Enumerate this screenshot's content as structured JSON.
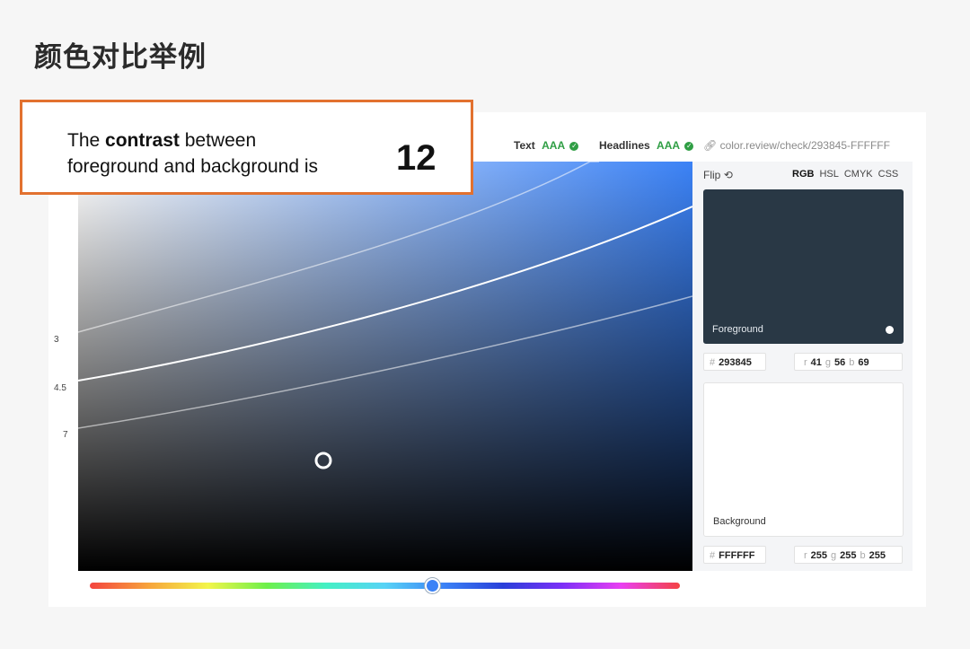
{
  "page_title": "颜色对比举例",
  "callout": {
    "line1_pre": "The ",
    "line1_bold": "contrast",
    "line1_post": " between",
    "line2": "foreground and background is",
    "ratio": "12",
    "border_color": "#e2712f"
  },
  "header": {
    "text_label": "Text",
    "text_rating": "AAA",
    "headlines_label": "Headlines",
    "headlines_rating": "AAA",
    "url": "color.review/check/293845-FFFFFF",
    "pass_color": "#2f9e44"
  },
  "chart": {
    "y_ticks": [
      "3",
      "4.5",
      "7"
    ],
    "hue_position": 0.58
  },
  "panel": {
    "flip_label": "Flip",
    "modes": [
      "RGB",
      "HSL",
      "CMYK",
      "CSS"
    ],
    "active_mode": "RGB",
    "foreground": {
      "label": "Foreground",
      "hex_prefix": "#",
      "hex": "293845",
      "r_label": "r",
      "r": "41",
      "g_label": "g",
      "g": "56",
      "b_label": "b",
      "b": "69",
      "color": "#293845"
    },
    "background": {
      "label": "Background",
      "hex_prefix": "#",
      "hex": "FFFFFF",
      "r_label": "r",
      "r": "255",
      "g_label": "g",
      "g": "255",
      "b_label": "b",
      "b": "255",
      "color": "#FFFFFF"
    }
  }
}
